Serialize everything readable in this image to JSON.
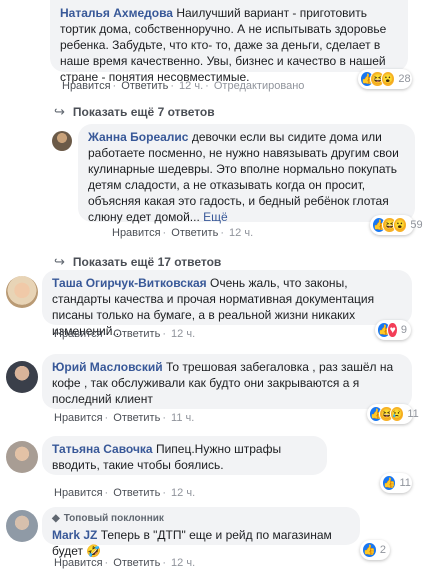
{
  "comments": [
    {
      "author": "Наталья Ахмедова",
      "text": "Наилучший вариант - приготовить тортик дома, собственноручно. А не испытывать здоровье ребенка. Забудьте, что кто- то, даже за деньги, сделает в наше время качественно. Увы, бизнес и качество в нашей стране - понятия несовместимые.",
      "like": "Нравится",
      "reply": "Ответить",
      "time": "12 ч.",
      "edited": "Отредактировано",
      "reactions": {
        "icons": [
          "like-icon",
          "haha-icon",
          "wow-icon"
        ],
        "count": "28"
      }
    },
    {
      "author": "Жанна Бореалис",
      "text": "девочки если вы сидите дома или работаете посменно, не нужно навязывать другим свои кулинарные шедевры. Это вполне нормально покупать детям сладости, а не отказывать когда он просит, объясняя какая это гадость, и бедный ребёнок глотая слюну едет домой...",
      "more": "Ещё",
      "like": "Нравится",
      "reply": "Ответить",
      "time": "12 ч.",
      "reactions": {
        "icons": [
          "like-icon",
          "haha-icon",
          "wow-icon"
        ],
        "count": "59"
      }
    },
    {
      "author": "Таша Огирчук-Витковская",
      "text": "Очень жаль, что законы, стандарты качества и прочая нормативная документация писаны только на бумаге, а в реальной жизни никаких изменений...",
      "like": "Нравится",
      "reply": "Ответить",
      "time": "12 ч.",
      "reactions": {
        "icons": [
          "like-icon",
          "love-icon"
        ],
        "count": "9"
      }
    },
    {
      "author": "Юрий Масловский",
      "text": "То трешовая забегаловка , раз зашёл на кофе , так обслуживали как будто они закрываются а я последний клиент",
      "like": "Нравится",
      "reply": "Ответить",
      "time": "11 ч.",
      "reactions": {
        "icons": [
          "like-icon",
          "haha-icon",
          "sad-icon"
        ],
        "count": "11"
      }
    },
    {
      "author": "Татьяна Савочка",
      "text": "Пипец.Нужно штрафы вводить, такие чтобы боялись.",
      "like": "Нравится",
      "reply": "Ответить",
      "time": "12 ч.",
      "reactions": {
        "icons": [
          "like-icon"
        ],
        "count": "11"
      }
    },
    {
      "badge": "Топовый поклонник",
      "author": "Mark JZ",
      "text": "Теперь в \"ДТП\" еще и рейд по магазинам будет",
      "emoji": "🤣",
      "like": "Нравится",
      "reply": "Ответить",
      "time": "12 ч.",
      "reactions": {
        "icons": [
          "like-icon"
        ],
        "count": "2"
      }
    }
  ],
  "show_more": [
    {
      "label": "Показать ещё 7 ответов"
    },
    {
      "label": "Показать ещё 17 ответов"
    }
  ]
}
